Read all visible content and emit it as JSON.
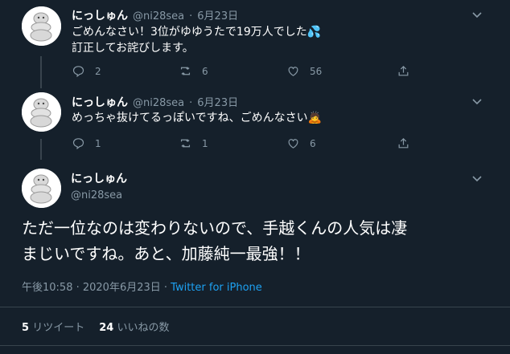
{
  "tweets": [
    {
      "display_name": "にっしゅん",
      "handle": "@ni28sea",
      "sep": "·",
      "date": "6月23日",
      "lines": [
        "ごめんなさい！3位がゆゆうたで19万人でした💦",
        "訂正してお詫びします。"
      ],
      "replies": "2",
      "retweets": "6",
      "likes": "56"
    },
    {
      "display_name": "にっしゅん",
      "handle": "@ni28sea",
      "sep": "·",
      "date": "6月23日",
      "lines": [
        "めっちゃ抜けてるっぽいですね、ごめんなさい🙇"
      ],
      "replies": "1",
      "retweets": "1",
      "likes": "6"
    }
  ],
  "main_tweet": {
    "display_name": "にっしゅん",
    "handle": "@ni28sea",
    "lines": [
      "ただ一位なのは変わりないので、手越くんの人気は凄",
      "まじいですね。あと、加藤純一最強！！"
    ],
    "timestamp": "午後10:58 · 2020年6月23日 ·",
    "source": "Twitter for iPhone",
    "retweet_count": "5",
    "retweet_label": "リツイート",
    "like_count": "24",
    "like_label": "いいねの数"
  },
  "icons": {
    "reply": "reply-icon",
    "retweet": "retweet-icon",
    "like": "heart-icon",
    "share": "share-icon",
    "more": "chevron-down-icon"
  },
  "colors": {
    "background": "#15202b",
    "muted": "#8899a6",
    "accent": "#1da1f2",
    "border": "#38444d"
  }
}
